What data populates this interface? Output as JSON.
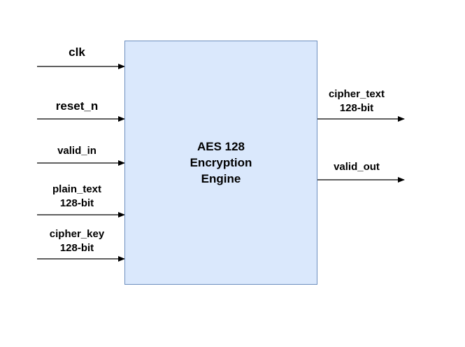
{
  "block": {
    "line1": "AES 128",
    "line2": "Encryption",
    "line3": "Engine"
  },
  "inputs": [
    {
      "name": "clk"
    },
    {
      "name": "reset_n"
    },
    {
      "name": "valid_in"
    },
    {
      "name": "plain_text",
      "width": "128-bit"
    },
    {
      "name": "cipher_key",
      "width": "128-bit"
    }
  ],
  "outputs": [
    {
      "name": "cipher_text",
      "width": "128-bit"
    },
    {
      "name": "valid_out"
    }
  ],
  "colors": {
    "block_fill": "#dae8fc",
    "block_border": "#6c8ebf",
    "line": "#000000",
    "text": "#000000"
  }
}
